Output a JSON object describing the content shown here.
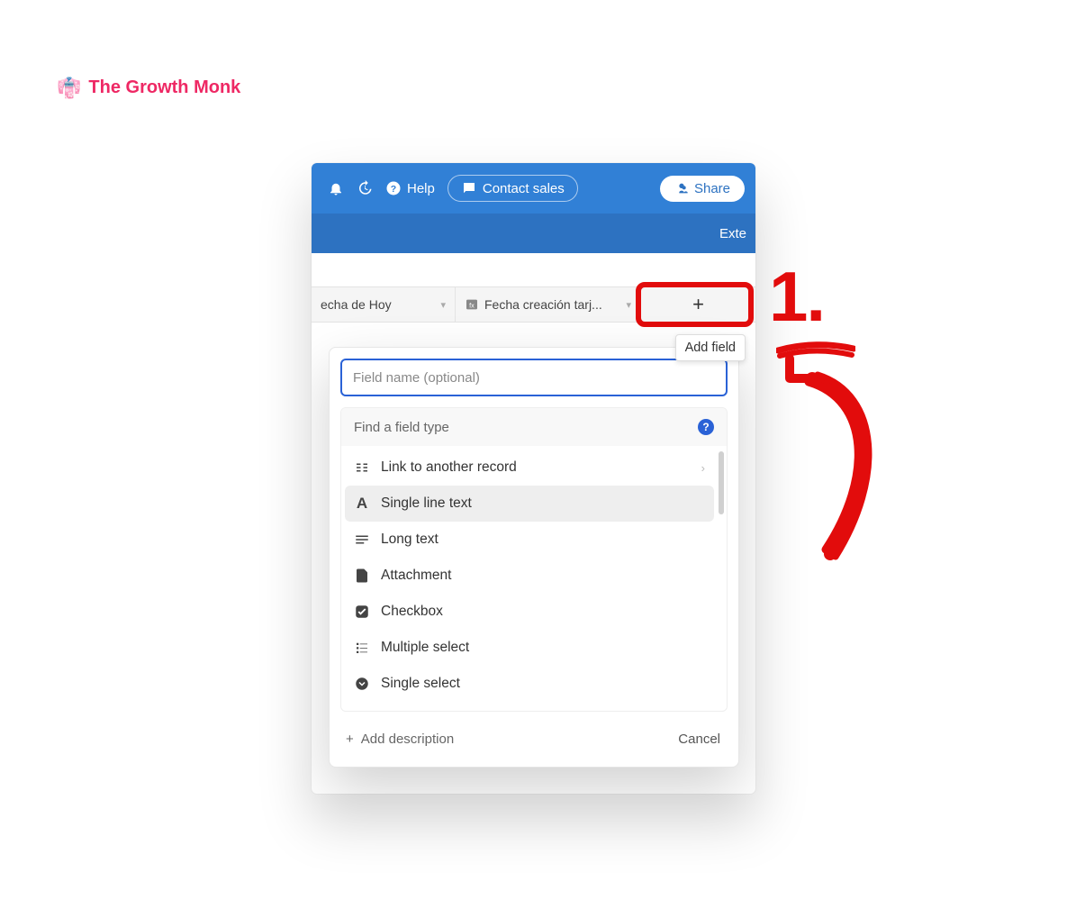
{
  "brand": {
    "name": "The Growth Monk",
    "icon": "👘"
  },
  "topbar": {
    "help_label": "Help",
    "contact_label": "Contact sales",
    "share_label": "Share"
  },
  "subbar": {
    "text": "Exte"
  },
  "columns": {
    "col1": "echa de Hoy",
    "col2": "Fecha creación tarj...",
    "add_symbol": "+"
  },
  "tooltip": {
    "add_field": "Add field"
  },
  "popover": {
    "fieldname_placeholder": "Field name (optional)",
    "find_type_label": "Find a field type",
    "types": [
      {
        "name": "Link to another record",
        "has_sub": true
      },
      {
        "name": "Single line text",
        "selected": true
      },
      {
        "name": "Long text"
      },
      {
        "name": "Attachment"
      },
      {
        "name": "Checkbox"
      },
      {
        "name": "Multiple select"
      },
      {
        "name": "Single select"
      }
    ],
    "add_description": "Add description",
    "cancel": "Cancel"
  },
  "annotation": {
    "number": "1."
  }
}
